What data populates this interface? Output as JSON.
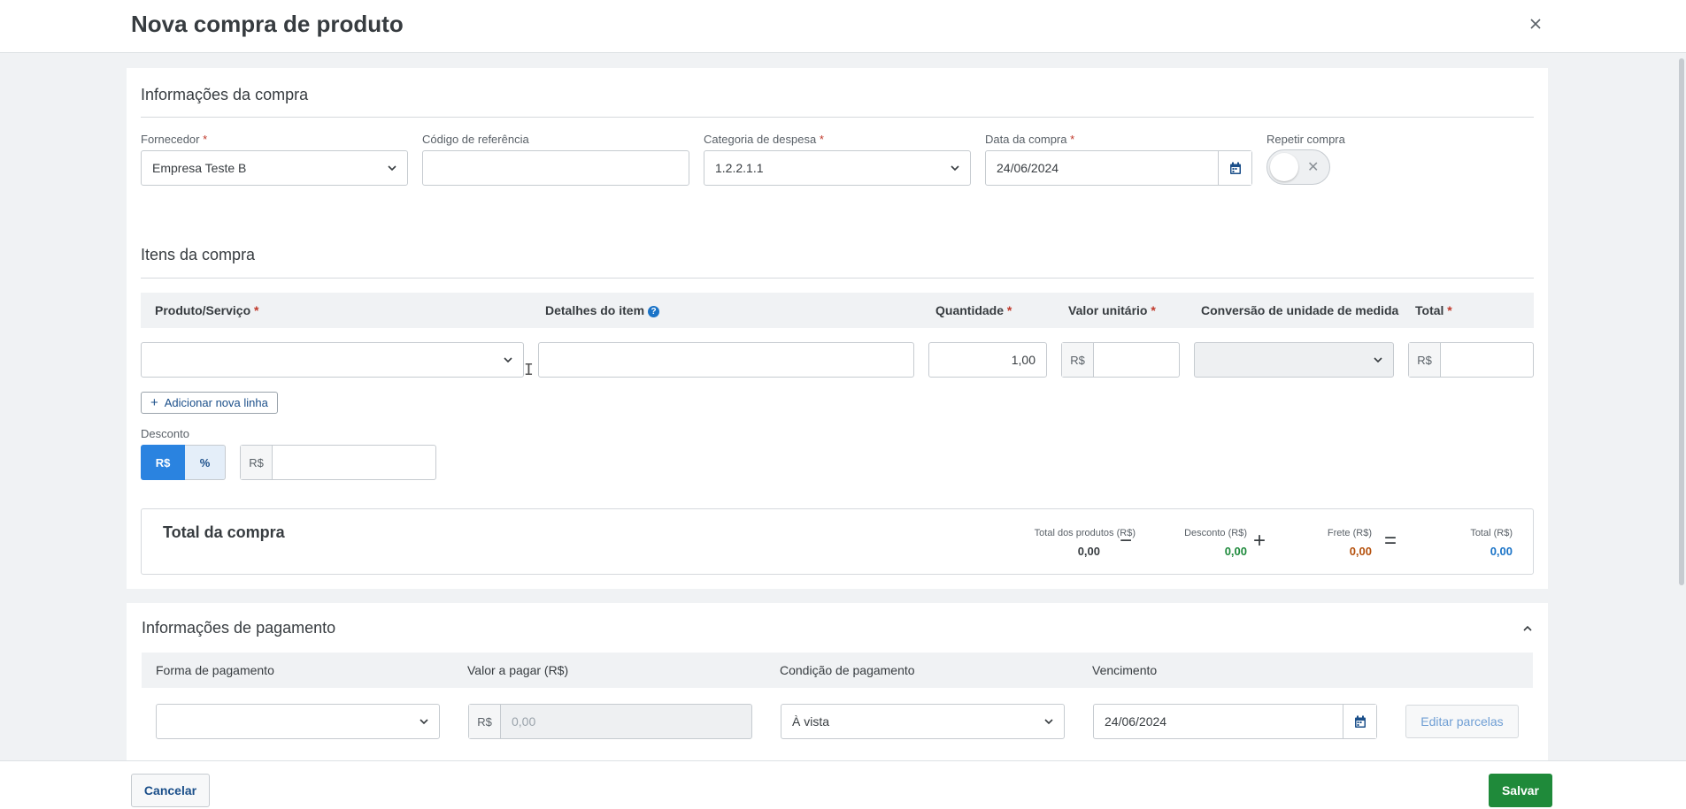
{
  "header": {
    "title": "Nova compra de produto",
    "close_icon": "×"
  },
  "purchase_info": {
    "title": "Informações da compra",
    "supplier": {
      "label": "Fornecedor",
      "required": "*",
      "value": "Empresa Teste B"
    },
    "reference": {
      "label": "Código de referência",
      "value": ""
    },
    "category": {
      "label": "Categoria de despesa",
      "required": "*",
      "value": "1.2.2.1.1"
    },
    "date": {
      "label": "Data da compra",
      "required": "*",
      "value": "24/06/2024"
    },
    "repeat": {
      "label": "Repetir compra",
      "enabled": false,
      "icon": "✕"
    }
  },
  "items": {
    "title": "Itens da compra",
    "columns": {
      "product": "Produto/Serviço",
      "details": "Detalhes do item",
      "quantity": "Quantidade",
      "unit_value": "Valor unitário",
      "conversion": "Conversão de unidade de medida",
      "total": "Total",
      "required": "*",
      "help_icon": "?"
    },
    "row": {
      "product": "",
      "details": "",
      "quantity": "1,00",
      "currency": "R$",
      "unit_value": "",
      "conversion": "",
      "total": ""
    },
    "add_line_icon": "+",
    "add_line_label": "Adicionar nova linha"
  },
  "discount": {
    "label": "Desconto",
    "mode_currency": "R$",
    "mode_percent": "%",
    "active_mode": "R$",
    "prefix": "R$",
    "value": ""
  },
  "totals": {
    "title": "Total da compra",
    "products": {
      "label": "Total dos produtos (R$)",
      "value": "0,00"
    },
    "discount": {
      "label": "Desconto (R$)",
      "value": "0,00"
    },
    "freight": {
      "label": "Frete (R$)",
      "value": "0,00"
    },
    "total": {
      "label": "Total (R$)",
      "value": "0,00"
    },
    "op_minus": "−",
    "op_plus": "+",
    "op_equals": "=",
    "colors": {
      "discount": "#1e8a3c",
      "freight": "#b5510d",
      "total": "#1a73c7"
    }
  },
  "payment": {
    "title": "Informações de pagamento",
    "columns": {
      "method": "Forma de pagamento",
      "amount": "Valor a pagar (R$)",
      "condition": "Condição de pagamento",
      "due": "Vencimento"
    },
    "row": {
      "method": "",
      "currency": "R$",
      "amount_placeholder": "0,00",
      "condition": "À vista",
      "due": "24/06/2024"
    },
    "edit_installments": "Editar parcelas"
  },
  "footer": {
    "cancel": "Cancelar",
    "save": "Salvar"
  },
  "colors": {
    "primary": "#2a83e0",
    "save": "#1f8a3a",
    "icon_blue": "#1b4f8a"
  }
}
